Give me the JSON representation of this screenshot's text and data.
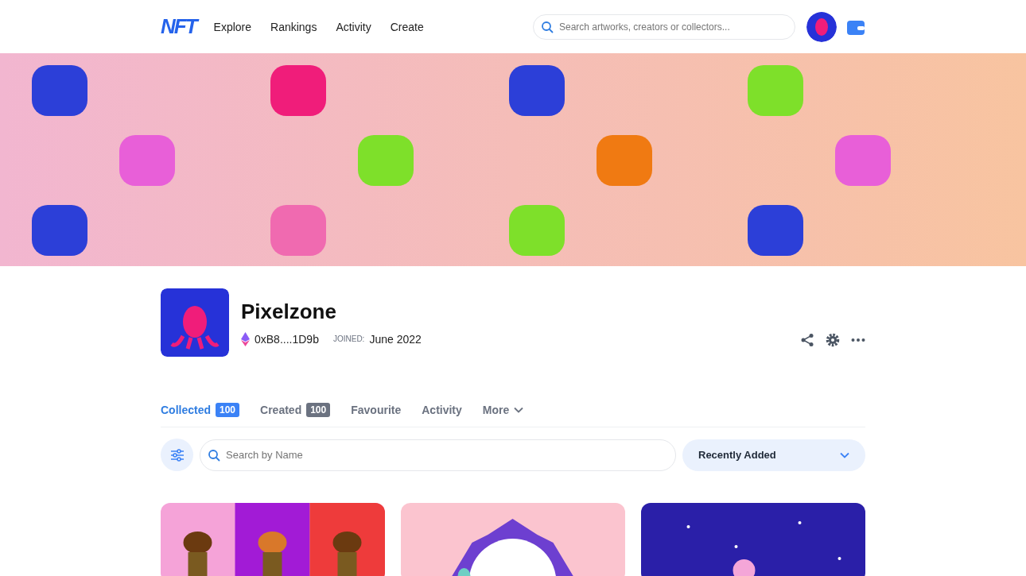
{
  "header": {
    "logo": "NFT",
    "nav": [
      {
        "label": "Explore"
      },
      {
        "label": "Rankings"
      },
      {
        "label": "Activity"
      },
      {
        "label": "Create"
      }
    ],
    "search": {
      "placeholder": "Search artworks, creators or collectors..."
    }
  },
  "profile": {
    "name": "Pixelzone",
    "address": "0xB8....1D9b",
    "joined_label": "JOINED:",
    "joined": "June 2022"
  },
  "tabs": [
    {
      "label": "Collected",
      "count": "100",
      "selected": true
    },
    {
      "label": "Created",
      "count": "100",
      "selected": false
    },
    {
      "label": "Favourite",
      "selected": false
    },
    {
      "label": "Activity",
      "selected": false
    },
    {
      "label": "More",
      "selected": false,
      "dropdown": true
    }
  ],
  "filter": {
    "search_placeholder": "Search by Name",
    "sort": "Recently Added"
  }
}
